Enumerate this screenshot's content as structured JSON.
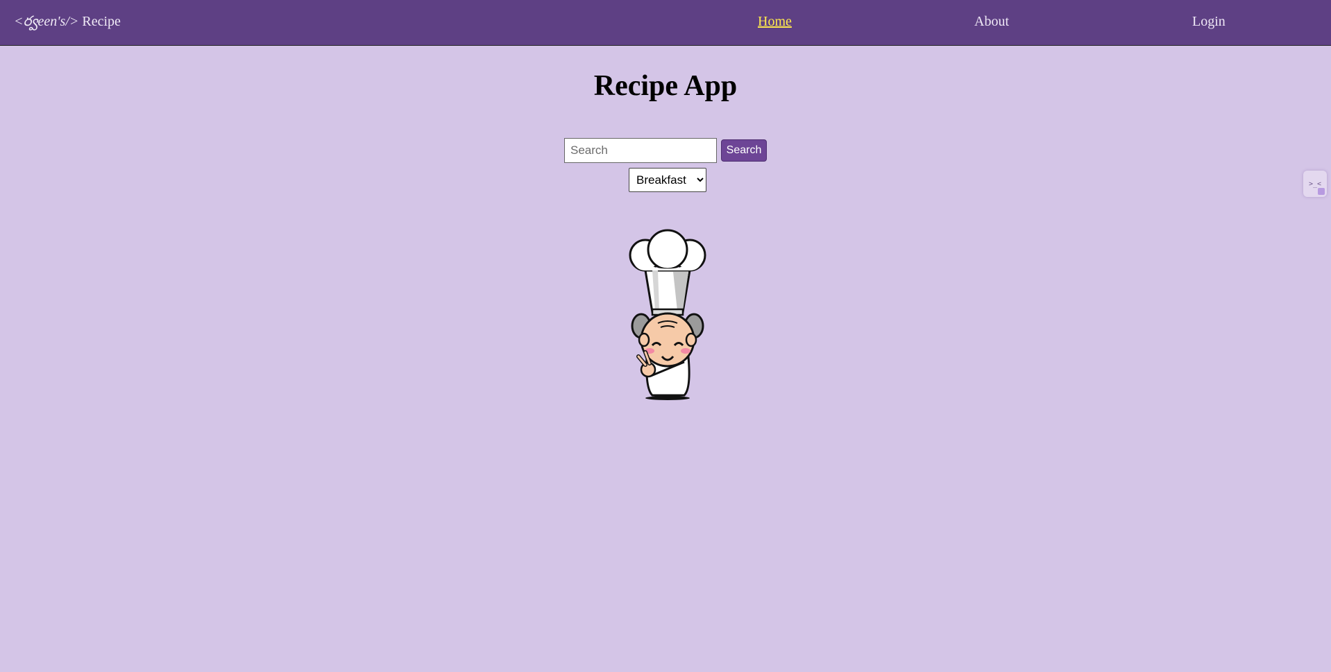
{
  "navbar": {
    "brand_tag": "<ర్వeen's/>",
    "brand_name": "Recipe",
    "links": [
      {
        "label": "Home",
        "active": true
      },
      {
        "label": "About",
        "active": false
      },
      {
        "label": "Login",
        "active": false
      }
    ]
  },
  "main": {
    "title": "Recipe App",
    "search": {
      "placeholder": "Search",
      "value": "",
      "button_label": "Search"
    },
    "category": {
      "selected": "Breakfast"
    },
    "illustration": "chef-mascot"
  },
  "side_widget": {
    "icon": "code-widget-icon",
    "glyph": ">_<"
  },
  "colors": {
    "navbar": "#5e4084",
    "background": "#d4c5e7",
    "active_link": "#ffe94d",
    "button": "#6d4596"
  }
}
